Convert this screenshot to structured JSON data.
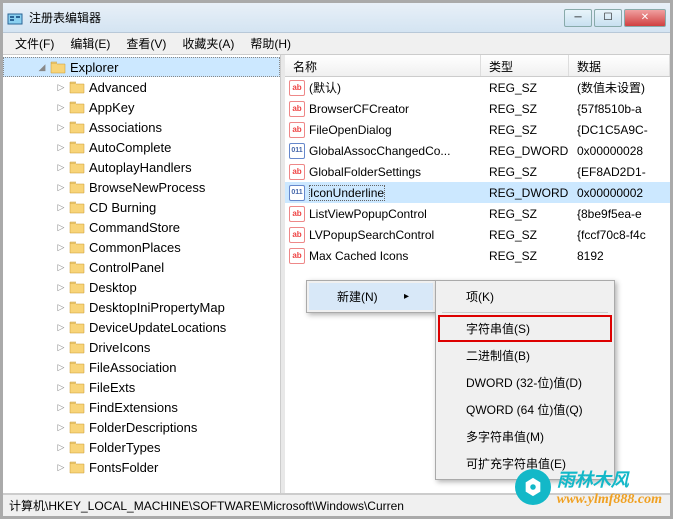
{
  "window": {
    "title": "注册表编辑器"
  },
  "menubar": [
    {
      "label": "文件(F)"
    },
    {
      "label": "编辑(E)"
    },
    {
      "label": "查看(V)"
    },
    {
      "label": "收藏夹(A)"
    },
    {
      "label": "帮助(H)"
    }
  ],
  "tree": {
    "root": "Explorer",
    "items": [
      "Advanced",
      "AppKey",
      "Associations",
      "AutoComplete",
      "AutoplayHandlers",
      "BrowseNewProcess",
      "CD Burning",
      "CommandStore",
      "CommonPlaces",
      "ControlPanel",
      "Desktop",
      "DesktopIniPropertyMap",
      "DeviceUpdateLocations",
      "DriveIcons",
      "FileAssociation",
      "FileExts",
      "FindExtensions",
      "FolderDescriptions",
      "FolderTypes",
      "FontsFolder"
    ]
  },
  "list": {
    "headers": {
      "name": "名称",
      "type": "类型",
      "data": "数据"
    },
    "rows": [
      {
        "name": "(默认)",
        "type": "REG_SZ",
        "data": "(数值未设置)",
        "icon": "sz"
      },
      {
        "name": "BrowserCFCreator",
        "type": "REG_SZ",
        "data": "{57f8510b-a",
        "icon": "sz"
      },
      {
        "name": "FileOpenDialog",
        "type": "REG_SZ",
        "data": "{DC1C5A9C-",
        "icon": "sz"
      },
      {
        "name": "GlobalAssocChangedCo...",
        "type": "REG_DWORD",
        "data": "0x00000028",
        "icon": "dw"
      },
      {
        "name": "GlobalFolderSettings",
        "type": "REG_SZ",
        "data": "{EF8AD2D1-",
        "icon": "sz"
      },
      {
        "name": "IconUnderline",
        "type": "REG_DWORD",
        "data": "0x00000002",
        "icon": "dw",
        "selected": true
      },
      {
        "name": "ListViewPopupControl",
        "type": "REG_SZ",
        "data": "{8be9f5ea-e",
        "icon": "sz"
      },
      {
        "name": "LVPopupSearchControl",
        "type": "REG_SZ",
        "data": "{fccf70c8-f4c",
        "icon": "sz"
      },
      {
        "name": "Max Cached Icons",
        "type": "REG_SZ",
        "data": "8192",
        "icon": "sz"
      }
    ]
  },
  "context_menu": {
    "parent": [
      {
        "label": "新建(N)",
        "hasSub": true
      }
    ],
    "sub": [
      {
        "label": "项(K)"
      },
      {
        "sep": true
      },
      {
        "label": "字符串值(S)",
        "highlighted": true
      },
      {
        "label": "二进制值(B)"
      },
      {
        "label": "DWORD (32-位)值(D)"
      },
      {
        "label": "QWORD (64 位)值(Q)"
      },
      {
        "label": "多字符串值(M)"
      },
      {
        "label": "可扩充字符串值(E)"
      }
    ]
  },
  "statusbar": {
    "path": "计算机\\HKEY_LOCAL_MACHINE\\SOFTWARE\\Microsoft\\Windows\\Curren"
  },
  "watermark": {
    "brand": "雨林木风",
    "url": "www.ylmf888.com"
  }
}
